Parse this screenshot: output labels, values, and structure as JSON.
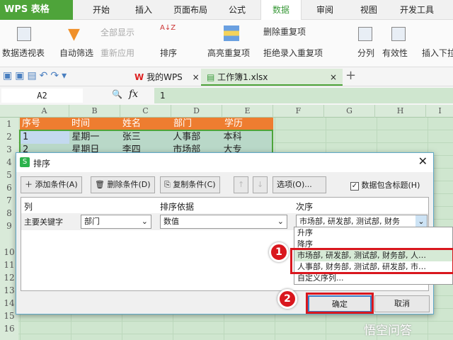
{
  "app": {
    "brand": "WPS 表格"
  },
  "menu_tabs": [
    "开始",
    "插入",
    "页面布局",
    "公式",
    "数据",
    "审阅",
    "视图",
    "开发工具"
  ],
  "ribbon": {
    "pivot": "数据透视表",
    "autofilter": "自动筛选",
    "show_all": "全部显示",
    "reapply": "重新应用",
    "sort": "排序",
    "highlight_dup": "高亮重复项",
    "remove_dup": "删除重复项",
    "reject_dup": "拒绝录入重复项",
    "split": "分列",
    "validity": "有效性",
    "insert_dropdown": "插入下拉"
  },
  "doc_tabs": [
    "我的WPS",
    "工作簿1.xlsx"
  ],
  "formula": {
    "name_box": "A2",
    "fx": "fx",
    "value": "1"
  },
  "columns": [
    "A",
    "B",
    "C",
    "D",
    "E",
    "F",
    "G",
    "H",
    "I"
  ],
  "rows": [
    "1",
    "2",
    "3",
    "4",
    "5",
    "6",
    "7",
    "8",
    "9",
    "10",
    "11",
    "12",
    "13",
    "14",
    "15",
    "16"
  ],
  "sheet": [
    [
      "序号",
      "时间",
      "姓名",
      "部门",
      "学历"
    ],
    [
      "1",
      "星期一",
      "张三",
      "人事部",
      "本科"
    ],
    [
      "2",
      "星期日",
      "李四",
      "市场部",
      "大专"
    ]
  ],
  "dialog": {
    "title": "排序",
    "add": "添加条件(A)",
    "delete": "删除条件(D)",
    "copy": "复制条件(C)",
    "options": "选项(O)...",
    "has_header": "数据包含标题(H)",
    "has_header_checked": true,
    "headers": [
      "列",
      "排序依据",
      "次序"
    ],
    "row_label": "主要关键字",
    "column_value": "部门",
    "basis_value": "数值",
    "order_value": "市场部, 研发部, 测试部, 财务",
    "ok": "确定",
    "cancel": "取消"
  },
  "dropdown_options": [
    "升序",
    "降序",
    "市场部, 研发部, 测试部, 财务部, 人…",
    "人事部, 财务部, 测试部, 研发部, 市…",
    "自定义序列..."
  ],
  "annotations": [
    "1",
    "2"
  ],
  "watermark": "悟空问答"
}
